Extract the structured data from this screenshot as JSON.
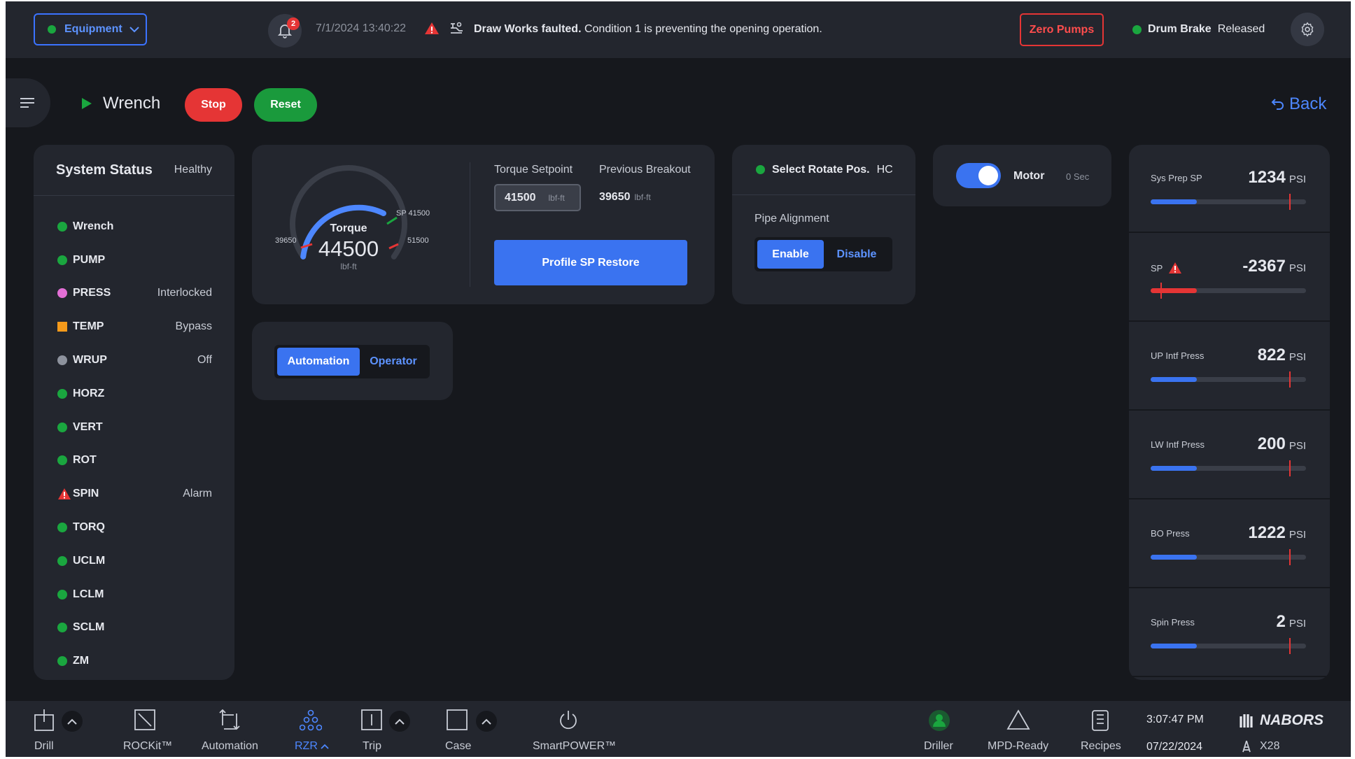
{
  "topbar": {
    "equipment_label": "Equipment",
    "notifications_count": "2",
    "datetime": "7/1/2024  13:40:22",
    "fault_title": "Draw Works faulted.",
    "fault_detail": " Condition 1 is preventing the opening operation.",
    "zero_pumps_label": "Zero Pumps",
    "drum_brake_label": "Drum Brake",
    "drum_brake_state": "Released"
  },
  "header": {
    "page_title": "Wrench",
    "stop_label": "Stop",
    "reset_label": "Reset",
    "back_label": "Back"
  },
  "system_status": {
    "title": "System Status",
    "health": "Healthy",
    "items": [
      {
        "name": "Wrench",
        "state": "",
        "indicator": "green"
      },
      {
        "name": "PUMP",
        "state": "",
        "indicator": "green"
      },
      {
        "name": "PRESS",
        "state": "Interlocked",
        "indicator": "pink"
      },
      {
        "name": "TEMP",
        "state": "Bypass",
        "indicator": "orange"
      },
      {
        "name": "WRUP",
        "state": "Off",
        "indicator": "gray"
      },
      {
        "name": "HORZ",
        "state": "",
        "indicator": "green"
      },
      {
        "name": "VERT",
        "state": "",
        "indicator": "green"
      },
      {
        "name": "ROT",
        "state": "",
        "indicator": "green"
      },
      {
        "name": "SPIN",
        "state": "Alarm",
        "indicator": "alarm"
      },
      {
        "name": "TORQ",
        "state": "",
        "indicator": "green"
      },
      {
        "name": "UCLM",
        "state": "",
        "indicator": "green"
      },
      {
        "name": "LCLM",
        "state": "",
        "indicator": "green"
      },
      {
        "name": "SCLM",
        "state": "",
        "indicator": "green"
      },
      {
        "name": "ZM",
        "state": "",
        "indicator": "green"
      }
    ]
  },
  "torque": {
    "gauge_label": "Torque",
    "value": "44500",
    "unit": "lbf-ft",
    "min_label": "39650",
    "sp_label": "SP 41500",
    "max_label": "51500",
    "setpoint_label": "Torque Setpoint",
    "setpoint_value": "41500",
    "setpoint_unit": "lbf-ft",
    "breakout_label": "Previous Breakout",
    "breakout_value": "39650",
    "breakout_unit": "lbf-ft",
    "restore_label": "Profile SP Restore"
  },
  "rotate": {
    "select_label": "Select Rotate Pos.",
    "select_value": "HC",
    "alignment_label": "Pipe Alignment",
    "enable_label": "Enable",
    "disable_label": "Disable"
  },
  "motor": {
    "label": "Motor",
    "time": "0 Sec",
    "on": true
  },
  "mode": {
    "automation_label": "Automation",
    "operator_label": "Operator"
  },
  "pressures": [
    {
      "name": "Sys Prep SP",
      "value": "1234",
      "unit": "PSI",
      "alarm": false
    },
    {
      "name": "SP",
      "value": "-2367",
      "unit": "PSI",
      "alarm": true
    },
    {
      "name": "UP Intf Press",
      "value": "822",
      "unit": "PSI",
      "alarm": false
    },
    {
      "name": "LW Intf Press",
      "value": "200",
      "unit": "PSI",
      "alarm": false
    },
    {
      "name": "BO Press",
      "value": "1222",
      "unit": "PSI",
      "alarm": false
    },
    {
      "name": "Spin Press",
      "value": "2",
      "unit": "PSI",
      "alarm": false
    }
  ],
  "bottom_nav": {
    "drill": "Drill",
    "rockit": "ROCKit™",
    "automation": "Automation",
    "rzr": "RZR",
    "trip": "Trip",
    "case": "Case",
    "smartpower": "SmartPOWER™",
    "driller": "Driller",
    "mpd": "MPD-Ready",
    "recipes": "Recipes",
    "time": "3:07:47 PM",
    "date": "07/22/2024",
    "brand": "NABORS",
    "rig": "X28"
  },
  "colors": {
    "accent": "#3a73f0",
    "danger": "#e53535",
    "ok": "#1aa63f",
    "warning": "#f59a1b",
    "panel": "#23262e",
    "background": "#16181d"
  }
}
